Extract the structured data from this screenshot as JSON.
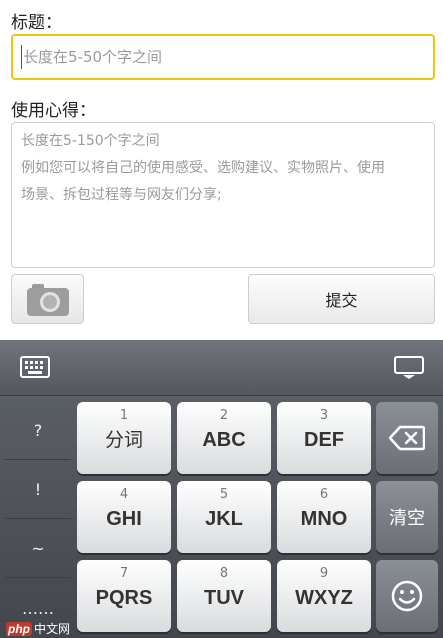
{
  "form": {
    "title_label": "标题：",
    "title_placeholder": "长度在5-50个字之间",
    "experience_label": "使用心得：",
    "experience_placeholder": [
      "长度在5-150个字之间",
      "例如您可以将自己的使用感受、选购建议、实物照片、使用",
      "场景、拆包过程等与网友们分享;"
    ],
    "submit_label": "提交",
    "camera_icon": "camera-icon"
  },
  "colors": {
    "focus_border": "#f1c40f",
    "keyboard_bg": "#4f5258",
    "key_bg": "#ffffff",
    "function_key_bg": "#7b7f86"
  },
  "keyboard": {
    "symbols": [
      "?",
      "!",
      "~",
      "……"
    ],
    "keys": [
      {
        "num": "1",
        "label": "分词"
      },
      {
        "num": "2",
        "label": "ABC"
      },
      {
        "num": "3",
        "label": "DEF"
      },
      {
        "num": "4",
        "label": "GHI"
      },
      {
        "num": "5",
        "label": "JKL"
      },
      {
        "num": "6",
        "label": "MNO"
      },
      {
        "num": "7",
        "label": "PQRS"
      },
      {
        "num": "8",
        "label": "TUV"
      },
      {
        "num": "9",
        "label": "WXYZ"
      }
    ],
    "clear_label": "清空",
    "icons": {
      "toggle": "keyboard-icon",
      "hide": "hide-keyboard-icon",
      "backspace": "backspace-icon",
      "emoji": "emoji-icon"
    }
  },
  "watermark": {
    "brand": "php",
    "text": "中文网"
  }
}
